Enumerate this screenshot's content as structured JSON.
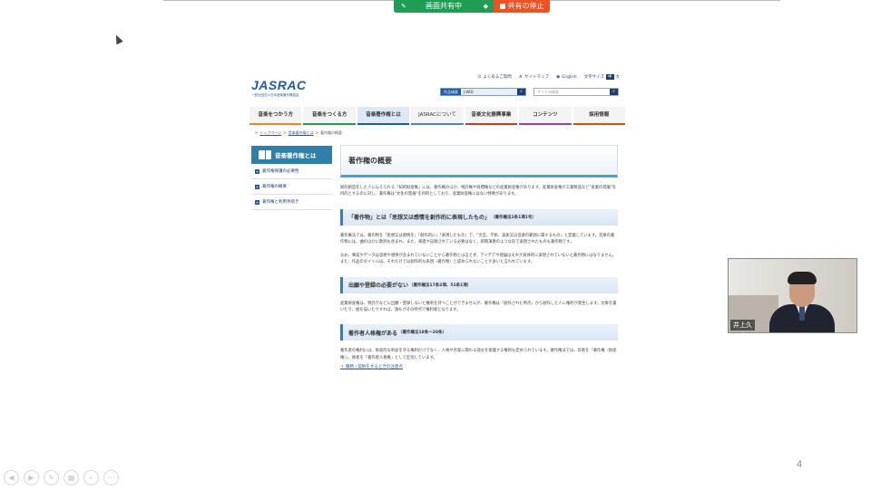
{
  "share_bar": {
    "sharing_label": "画面共有中",
    "stop_label": "共有の停止"
  },
  "site": {
    "logo": "JASRAC",
    "logo_sub": "一般社団法人日本音楽著作権協会",
    "utility": {
      "faq": "よくあるご質問",
      "sitemap": "サイトマップ",
      "english": "English",
      "font_size": "文字サイズ",
      "font_mid": "中",
      "font_large": "大"
    },
    "search": {
      "label": "作品検索",
      "value": "J-WID",
      "placeholder": "サイト内検索"
    },
    "nav": [
      "音楽をつかう方",
      "音楽をつくる方",
      "音楽著作権とは",
      "JASRACについて",
      "音楽文化振興事業",
      "コンテンツ",
      "採用情報"
    ],
    "breadcrumb": {
      "home": "トップページ",
      "parent": "音楽著作権とは",
      "current": "著作権の概要"
    },
    "sidebar": {
      "title": "音楽著作権とは",
      "items": [
        "著作権保護の必要性",
        "著作権の概要",
        "著作権と利用手続き"
      ]
    },
    "main": {
      "title": "著作権の概要",
      "intro": "知的創造をした人に与えられる「知的財産権」には、著作権のほか、特許権や商標権などの産業財産権があります。産業財産権が工業製品など\"産業の発展\"を目的とするのに対し、著作権は\"文化の発展\"を目的としており、産業財産権にはない特徴があります。",
      "sections": [
        {
          "heading": "「著作物」とは「思想又は感情を創作的に表現したもの」",
          "ref": "（著作権法2条1項1号）",
          "paragraphs": [
            "著作権法では、著作物を「思想又は感情を」「創作的に」「表現したもの」で、「文芸、学術、美術又は音楽の範囲に属するもの」と定義しています。音楽の著作物には、曲のほかに歌詞も含まれ、また、楽譜や記録されている必要はなく、即興演奏のような形で表現されたものも著作物です。",
            "なお、事実やデータは思想や感情が含まれていないことから著作物とは言えず、アイデアや理論はそれが具体的に表現されていないと著作物にはなりません。また、作品のタイトルは、それだけでは創作的な表現（著作物）と認められないことが多いと言われています。"
          ]
        },
        {
          "heading": "出願や登録の必要がない",
          "ref": "（著作権法17条2項、51条1項）",
          "paragraphs": [
            "産業財産権は、特許庁などに出願・登録しないと権利を持つことができませんが、著作権は「創作された時点」から創作した人に権利が発生します。文章を書いたり、絵を描いたりすれば、誰もがその時点で権利者となります。"
          ]
        },
        {
          "heading": "著作者人格権がある",
          "ref": "（著作権法18条～20条）",
          "paragraphs": [
            "著作者の権利には、財産的な利益を守る権利だけでなく、人格や名誉に関わる部分を保護する権利も定められています。著作権法では、前者を「著作権（財産権）」、後者を「著作者人格権」として区別しています。"
          ]
        }
      ],
      "more_link": "＋ 職務・契約をするときの注意点"
    }
  },
  "video": {
    "participant_name": "井上久"
  },
  "slide": {
    "page_number": "4"
  }
}
